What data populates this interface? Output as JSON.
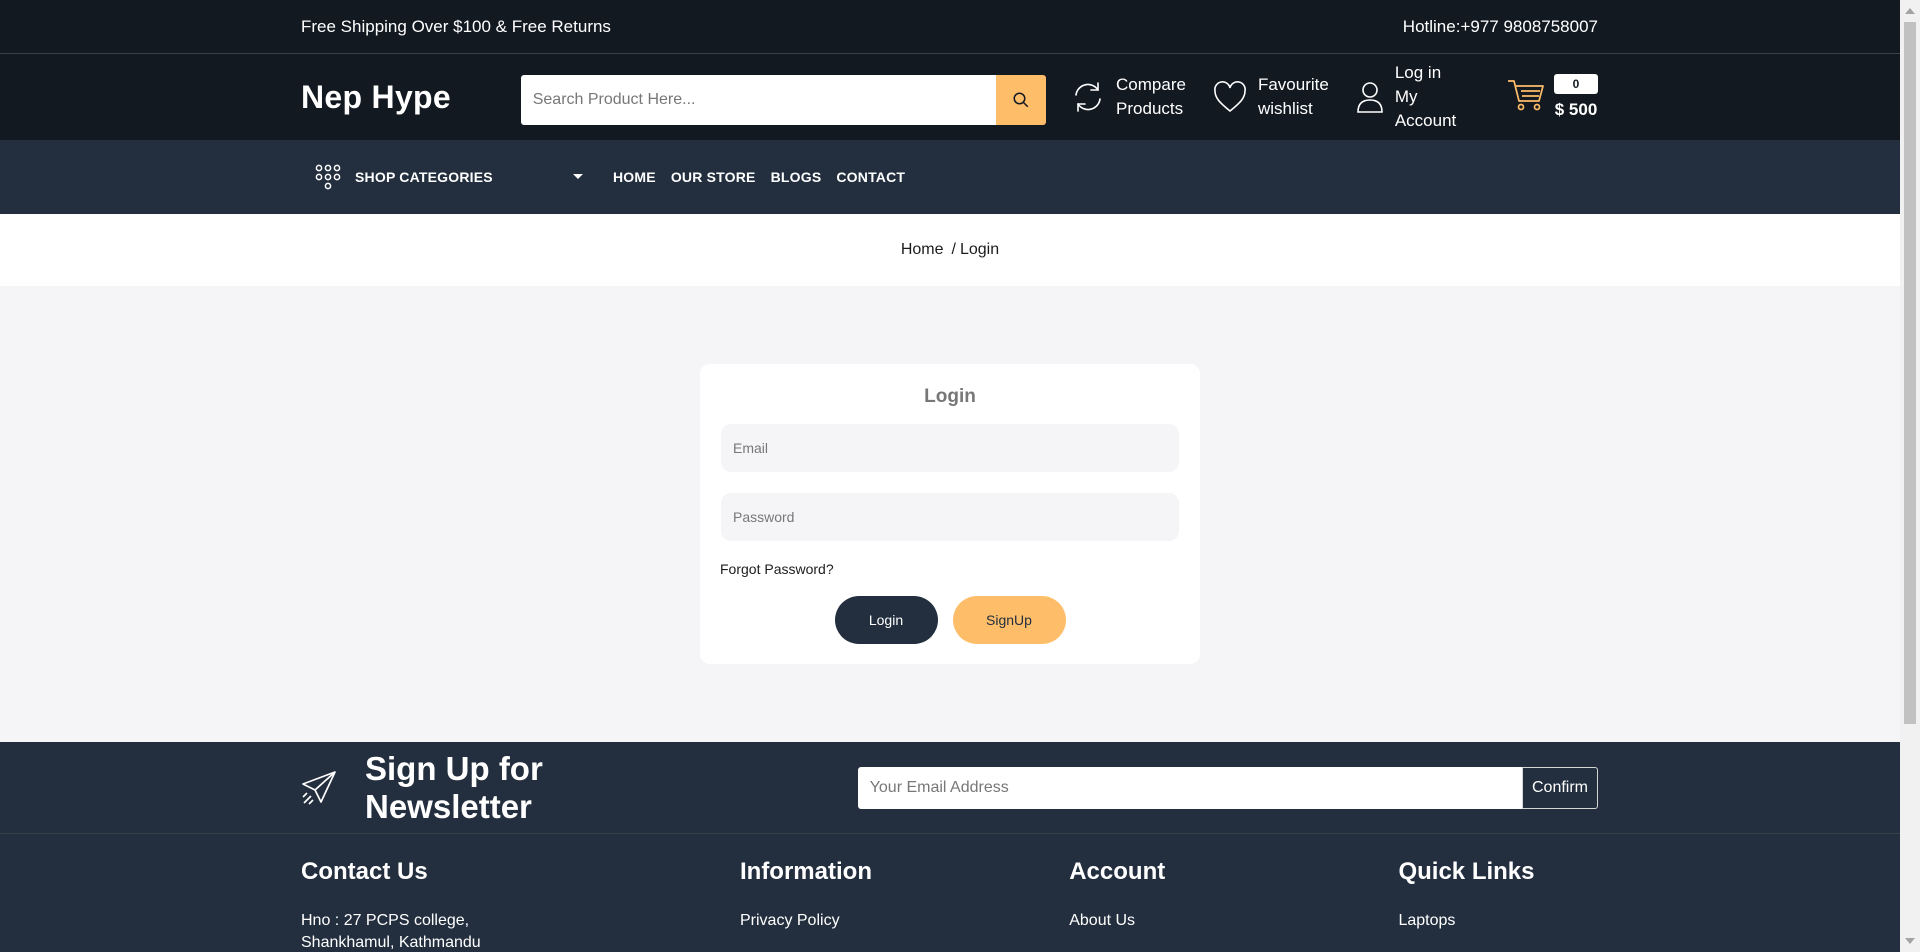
{
  "topbar": {
    "shipping_text": "Free Shipping Over $100 & Free Returns",
    "hotline": "Hotline:+977 9808758007"
  },
  "header": {
    "logo": "Nep Hype",
    "search_placeholder": "Search Product Here...",
    "compare": {
      "line1": "Compare",
      "line2": "Products"
    },
    "wishlist": {
      "line1": "Favourite",
      "line2": "wishlist"
    },
    "account": {
      "line1": "Log in",
      "line2": "My Account"
    },
    "cart": {
      "count": "0",
      "total": "$ 500"
    },
    "icons": {
      "search": "search-icon",
      "compare": "compare-icon",
      "wishlist": "heart-icon",
      "account": "user-icon",
      "cart": "cart-icon"
    },
    "colors": {
      "dark": "#131921",
      "accent": "#febd69"
    }
  },
  "nav": {
    "categories_label": "SHOP CATEGORIES",
    "menu": [
      "HOME",
      "OUR STORE",
      "BLOGS",
      "CONTACT"
    ],
    "color": "#232f3e"
  },
  "breadcrumb": {
    "home": "Home",
    "sep": "/",
    "current": "Login"
  },
  "login": {
    "title": "Login",
    "email_placeholder": "Email",
    "password_placeholder": "Password",
    "forgot": "Forgot Password?",
    "login_btn": "Login",
    "signup_btn": "SignUp"
  },
  "newsletter": {
    "title": "Sign Up for Newsletter",
    "placeholder": "Your Email Address",
    "confirm": "Confirm"
  },
  "footer": {
    "contact": {
      "title": "Contact Us",
      "line1": "Hno : 27 PCPS college,",
      "line2": "Shankhamul, Kathmandu"
    },
    "information": {
      "title": "Information",
      "first": "Privacy Policy"
    },
    "account": {
      "title": "Account",
      "first": "About Us"
    },
    "quick_links": {
      "title": "Quick Links",
      "first": "Laptops"
    }
  }
}
